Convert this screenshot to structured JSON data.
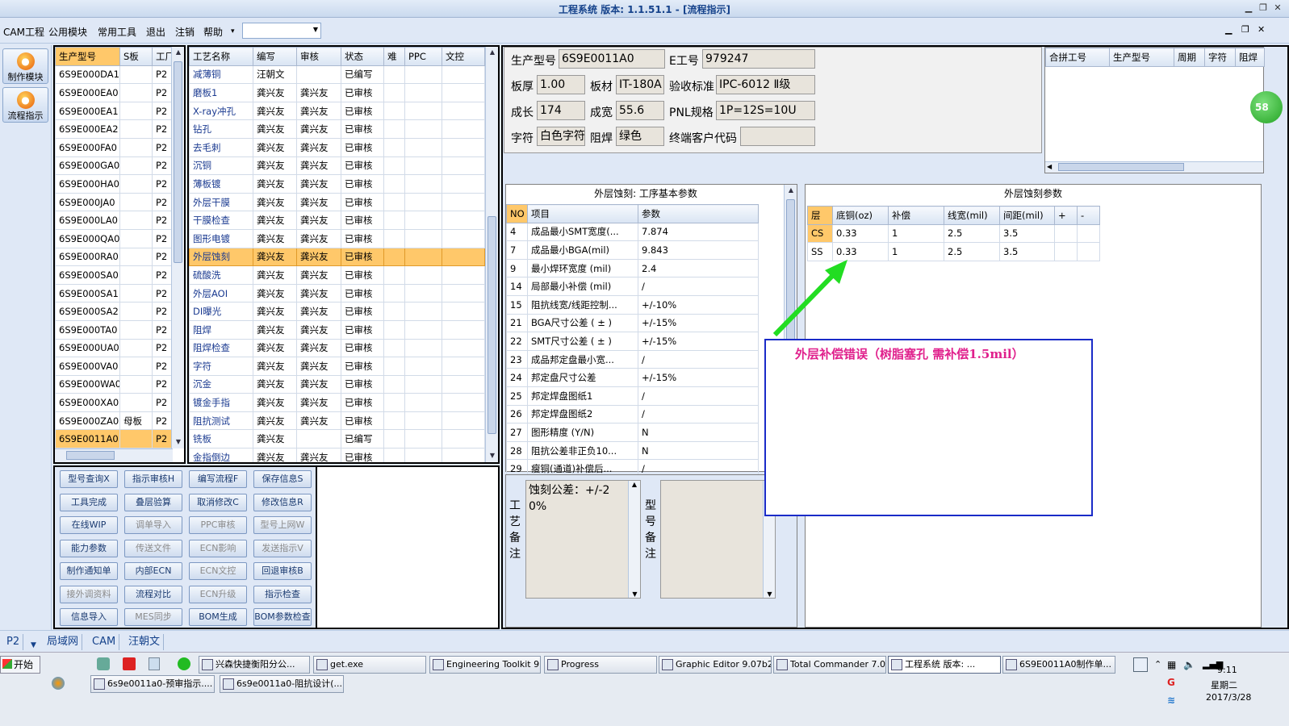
{
  "window": {
    "title": "工程系统  版本: 1.1.51.1 - [流程指示]"
  },
  "menu": {
    "items": [
      "CAM工程",
      "公用模块",
      "常用工具",
      "退出",
      "注销",
      "帮助"
    ],
    "help_arrow": "▾",
    "combo_value": ""
  },
  "sidebar": {
    "make_label": "制作模块",
    "flow_label": "流程指示"
  },
  "models_table": {
    "headers": [
      "生产型号",
      "S板",
      "工厂"
    ],
    "rows": [
      [
        "6S9E000DA1",
        "",
        "P2"
      ],
      [
        "6S9E000EA0",
        "",
        "P2"
      ],
      [
        "6S9E000EA1",
        "",
        "P2"
      ],
      [
        "6S9E000EA2",
        "",
        "P2"
      ],
      [
        "6S9E000FA0",
        "",
        "P2"
      ],
      [
        "6S9E000GA0",
        "",
        "P2"
      ],
      [
        "6S9E000HA0",
        "",
        "P2"
      ],
      [
        "6S9E000JA0",
        "",
        "P2"
      ],
      [
        "6S9E000LA0",
        "",
        "P2"
      ],
      [
        "6S9E000QA0",
        "",
        "P2"
      ],
      [
        "6S9E000RA0",
        "",
        "P2"
      ],
      [
        "6S9E000SA0",
        "",
        "P2"
      ],
      [
        "6S9E000SA1",
        "",
        "P2"
      ],
      [
        "6S9E000SA2",
        "",
        "P2"
      ],
      [
        "6S9E000TA0",
        "",
        "P2"
      ],
      [
        "6S9E000UA0",
        "",
        "P2"
      ],
      [
        "6S9E000VA0",
        "",
        "P2"
      ],
      [
        "6S9E000WA0",
        "",
        "P2"
      ],
      [
        "6S9E000XA0",
        "",
        "P2"
      ],
      [
        "6S9E000ZA0",
        "母板",
        "P2"
      ],
      [
        "6S9E0011A0",
        "",
        "P2"
      ]
    ],
    "selected_index": 20
  },
  "process_table": {
    "headers": [
      "工艺名称",
      "编写",
      "审核",
      "状态",
      "难",
      "PPC",
      "文控"
    ],
    "rows": [
      [
        "减薄铜",
        "汪朝文",
        "",
        "已编写"
      ],
      [
        "磨板1",
        "龚兴友",
        "龚兴友",
        "已审核"
      ],
      [
        "X-ray冲孔",
        "龚兴友",
        "龚兴友",
        "已审核"
      ],
      [
        "钻孔",
        "龚兴友",
        "龚兴友",
        "已审核"
      ],
      [
        "去毛刺",
        "龚兴友",
        "龚兴友",
        "已审核"
      ],
      [
        "沉铜",
        "龚兴友",
        "龚兴友",
        "已审核"
      ],
      [
        "薄板镀",
        "龚兴友",
        "龚兴友",
        "已审核"
      ],
      [
        "外层干膜",
        "龚兴友",
        "龚兴友",
        "已审核"
      ],
      [
        "干膜检查",
        "龚兴友",
        "龚兴友",
        "已审核"
      ],
      [
        "图形电镀",
        "龚兴友",
        "龚兴友",
        "已审核"
      ],
      [
        "外层蚀刻",
        "龚兴友",
        "龚兴友",
        "已审核"
      ],
      [
        "硫酸洗",
        "龚兴友",
        "龚兴友",
        "已审核"
      ],
      [
        "外层AOI",
        "龚兴友",
        "龚兴友",
        "已审核"
      ],
      [
        "DI曝光",
        "龚兴友",
        "龚兴友",
        "已审核"
      ],
      [
        "阻焊",
        "龚兴友",
        "龚兴友",
        "已审核"
      ],
      [
        "阻焊检查",
        "龚兴友",
        "龚兴友",
        "已审核"
      ],
      [
        "字符",
        "龚兴友",
        "龚兴友",
        "已审核"
      ],
      [
        "沉金",
        "龚兴友",
        "龚兴友",
        "已审核"
      ],
      [
        "镀金手指",
        "龚兴友",
        "龚兴友",
        "已审核"
      ],
      [
        "阻抗测试",
        "龚兴友",
        "龚兴友",
        "已审核"
      ],
      [
        "铣板",
        "龚兴友",
        "",
        "已编写"
      ],
      [
        "金指倒边",
        "龚兴友",
        "龚兴友",
        "已审核"
      ]
    ],
    "selected_index": 10
  },
  "buttons": [
    [
      "型号查询X",
      "指示审核H",
      "编写流程F",
      "保存信息S"
    ],
    [
      "工具完成",
      "叠层验算",
      "取消修改C",
      "修改信息R"
    ],
    [
      "在线WIP",
      "调单导入",
      "PPC审核",
      "型号上网W"
    ],
    [
      "能力参数",
      "传送文件",
      "ECN影响",
      "发送指示V"
    ],
    [
      "制作通知单",
      "内部ECN",
      "ECN文控",
      "回退审核B"
    ],
    [
      "接外调资料",
      "流程对比",
      "ECN升级",
      "指示检查"
    ],
    [
      "信息导入",
      "MES同步",
      "BOM生成",
      "BOM参数检查"
    ]
  ],
  "info": {
    "model_label": "生产型号",
    "model_value": "6S9E0011A0",
    "e_label": "E工号",
    "e_value": "979247",
    "thick_label": "板厚",
    "thick_value": "1.00",
    "mat_label": "板材",
    "mat_value": "IT-180A",
    "std_label": "验收标准",
    "std_value": "IPC-6012 Ⅱ级",
    "len_label": "成长",
    "len_value": "174",
    "wid_label": "成宽",
    "wid_value": "55.6",
    "pnl_label": "PNL规格",
    "pnl_value": "1P=12S=10U",
    "char_label": "字符",
    "char_value": "白色字符",
    "mask_label": "阻焊",
    "mask_value": "绿色",
    "cust_label": "终端客户代码",
    "cust_value": ""
  },
  "merge_table": {
    "headers": [
      "合拼工号",
      "生产型号",
      "周期",
      "字符",
      "阻焊"
    ]
  },
  "badge": "58",
  "params": {
    "title": "外层蚀刻: 工序基本参数",
    "headers": [
      "NO",
      "项目",
      "参数"
    ],
    "rows": [
      [
        "4",
        "成品最小SMT宽度(...",
        "7.874"
      ],
      [
        "7",
        "成品最小BGA(mil)",
        "9.843"
      ],
      [
        "9",
        "最小焊环宽度 (mil)",
        "2.4"
      ],
      [
        "14",
        "局部最小补偿 (mil)",
        "/"
      ],
      [
        "15",
        "阻抗线宽/线距控制...",
        "+/-10%"
      ],
      [
        "21",
        "BGA尺寸公差 ( ± )",
        "+/-15%"
      ],
      [
        "22",
        "SMT尺寸公差 ( ± )",
        "+/-15%"
      ],
      [
        "23",
        "成品邦定盘最小宽...",
        "/"
      ],
      [
        "24",
        "邦定盘尺寸公差",
        "+/-15%"
      ],
      [
        "25",
        "邦定焊盘图纸1",
        "/"
      ],
      [
        "26",
        "邦定焊盘图纸2",
        "/"
      ],
      [
        "27",
        "图形精度 (Y/N)",
        "N"
      ],
      [
        "28",
        "阻抗公差非正负10...",
        "N"
      ],
      [
        "29",
        "瘦铜(通道)补偿后...",
        "/"
      ]
    ]
  },
  "etch": {
    "title": "外层蚀刻参数",
    "headers": [
      "层",
      "底铜(oz)",
      "补偿",
      "线宽(mil)",
      "间距(mil)",
      "+",
      "-"
    ],
    "rows": [
      [
        "CS",
        "0.33",
        "1",
        "2.5",
        "3.5"
      ],
      [
        "SS",
        "0.33",
        "1",
        "2.5",
        "3.5"
      ]
    ]
  },
  "notes": {
    "process_label": "工艺备注",
    "process_text": "蚀刻公差：+/-20%",
    "model_label": "型号备注",
    "model_text": ""
  },
  "annotation": {
    "text": "外层补偿错误（树脂塞孔  需补偿1.5mil）",
    "color": "#e0208c",
    "arrow_color": "#22dd22"
  },
  "statusbar": {
    "factory": "P2",
    "net": "局域网",
    "cam": "CAM",
    "user": "汪朝文"
  },
  "taskbar": {
    "start": "开始",
    "tasks_row1": [
      "兴森快捷衡阳分公...",
      "get.exe",
      "Engineering Toolkit 9....",
      "Progress",
      "Graphic Editor 9.07b2...",
      "Total Commander 7.0...",
      "工程系统  版本: ...",
      "6S9E0011A0制作单..."
    ],
    "tasks_row2": [
      "6s9e0011a0-预审指示....",
      "6s9e0011a0-阻抗设计(..."
    ],
    "time": "9:11",
    "weekday": "星期二",
    "date": "2017/3/28"
  }
}
